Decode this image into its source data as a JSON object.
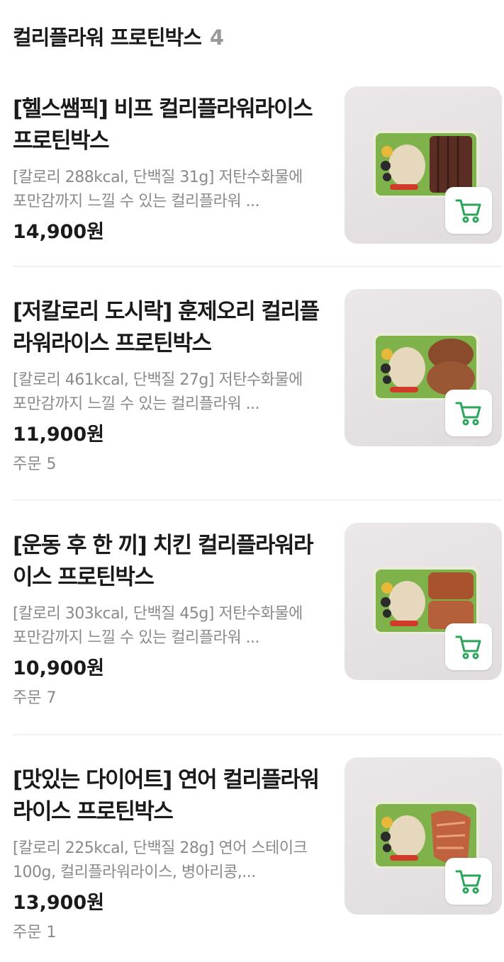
{
  "header": {
    "title": "컬리플라워 프로틴박스",
    "count": "4"
  },
  "items": [
    {
      "name": "[헬스쌤픽] 비프 컬리플라워라이스 프로틴박스",
      "desc": "[칼로리 288kcal, 단백질 31g] 저탄수화물에 포만감까지 느낄 수 있는 컬리플라워 ...",
      "price": "14,900원",
      "orders": "",
      "protein": "beef"
    },
    {
      "name": "[저칼로리 도시락] 훈제오리 컬리플라워라이스 프로틴박스",
      "desc": "[칼로리 461kcal, 단백질 27g] 저탄수화물에 포만감까지 느낄 수 있는 컬리플라워 ...",
      "price": "11,900원",
      "orders": "주문 5",
      "protein": "duck"
    },
    {
      "name": "[운동 후 한 끼] 치킨 컬리플라워라이스 프로틴박스",
      "desc": "[칼로리 303kcal, 단백질 45g] 저탄수화물에 포만감까지 느낄 수 있는 컬리플라워 ...",
      "price": "10,900원",
      "orders": "주문 7",
      "protein": "chicken"
    },
    {
      "name": "[맛있는 다이어트] 연어 컬리플라워라이스 프로틴박스",
      "desc": "[칼로리 225kcal, 단백질 28g] 연어 스테이크 100g, 컬리플라워라이스, 병아리콩,...",
      "price": "13,900원",
      "orders": "주문 1",
      "protein": "salmon"
    }
  ],
  "colors": {
    "cart_icon": "#2aa55a",
    "price_text": "#1a1a1a",
    "muted_text": "#8a8a8a"
  },
  "icons": {
    "cart": "shopping-cart-icon"
  }
}
